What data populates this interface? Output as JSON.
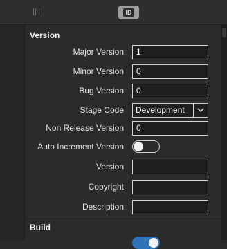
{
  "toolbar": {
    "id_button_label": "ID"
  },
  "sections": {
    "version": {
      "title": "Version"
    },
    "build": {
      "title": "Build"
    }
  },
  "fields": {
    "major_version": {
      "label": "Major Version",
      "value": "1"
    },
    "minor_version": {
      "label": "Minor Version",
      "value": "0"
    },
    "bug_version": {
      "label": "Bug Version",
      "value": "0"
    },
    "stage_code": {
      "label": "Stage Code",
      "value": "Development"
    },
    "non_release_version": {
      "label": "Non Release Version",
      "value": "0"
    },
    "auto_increment_version": {
      "label": "Auto Increment Version",
      "on": false
    },
    "version": {
      "label": "Version",
      "value": ""
    },
    "copyright": {
      "label": "Copyright",
      "value": ""
    },
    "description": {
      "label": "Description",
      "value": ""
    }
  },
  "build": {
    "toggle_on": true
  },
  "colors": {
    "accent": "#2f73b8",
    "background": "#2b2b2b",
    "field_border": "#d4d4d4"
  }
}
